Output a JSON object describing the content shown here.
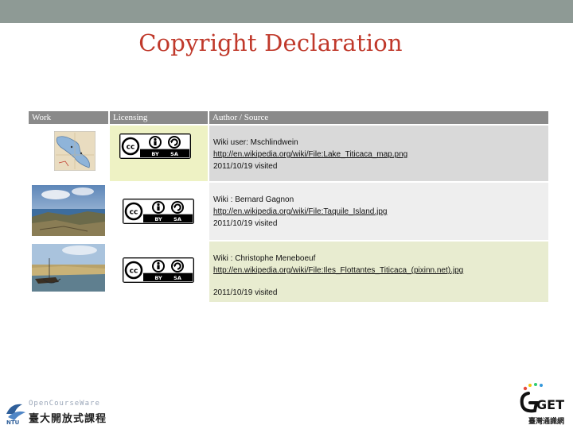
{
  "title": "Copyright Declaration",
  "table": {
    "headers": [
      "Work",
      "Licensing",
      "Author / Source"
    ],
    "rows": [
      {
        "work_icon": "lake-titicaca-map-thumbnail",
        "license_icon": "cc-by-sa-icon",
        "author": "Wiki user: Mschlindwein",
        "url": "http://en.wikipedia.org/wiki/File:Lake_Titicaca_map.png",
        "visited": "2011/10/19 visited"
      },
      {
        "work_icon": "taquile-island-photo-thumbnail",
        "license_icon": "cc-by-sa-icon",
        "author": "Wiki : Bernard Gagnon",
        "url": "http://en.wikipedia.org/wiki/File:Taquile_Island.jpg",
        "visited": "2011/10/19 visited"
      },
      {
        "work_icon": "floating-islands-photo-thumbnail",
        "license_icon": "cc-by-sa-icon",
        "author": "Wiki : Christophe Meneboeuf",
        "url": "http://en.wikipedia.org/wiki/File:Iles_Flottantes_Titicaca_(pixinn.net).jpg",
        "visited": "2011/10/19 visited"
      }
    ]
  },
  "cc_badge": {
    "cc": "cc",
    "by": "BY",
    "sa": "SA"
  },
  "footer": {
    "ocw_logo_text": "OpenCourseWare",
    "ocw_logo_cn": "臺大開放式課程",
    "get_logo_text": "GET",
    "get_logo_cn": "臺灣通識網"
  },
  "colors": {
    "title": "#c0392b",
    "top_bar": "#8e9a95",
    "header_row": "#8a8a8a",
    "row1": "#d9d9d9",
    "row2": "#eeeeee",
    "row3": "#e8ecd0"
  }
}
